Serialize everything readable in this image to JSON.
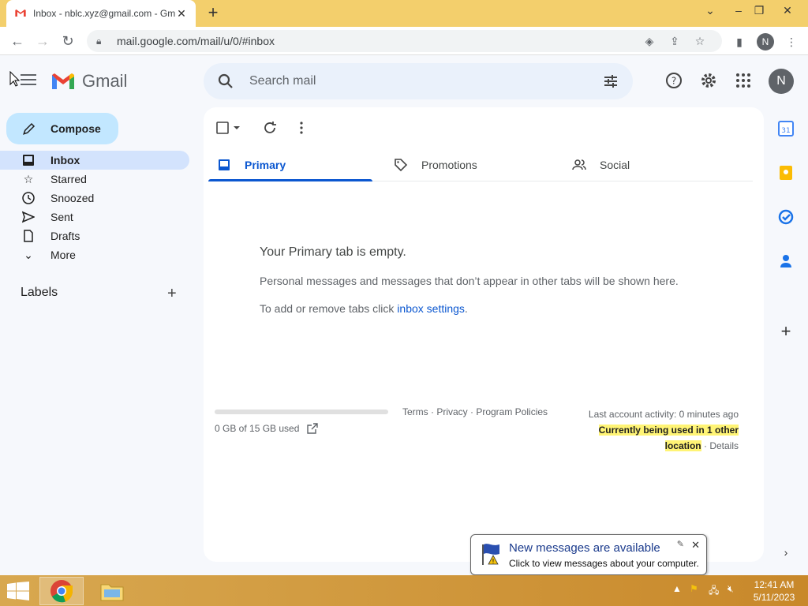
{
  "browser": {
    "tab_title": "Inbox - nblc.xyz@gmail.com - Gmail",
    "url": "mail.google.com/mail/u/0/#inbox",
    "profile_initial": "N"
  },
  "gmail": {
    "logo_text": "Gmail",
    "search_placeholder": "Search mail",
    "avatar_initial": "N",
    "compose_label": "Compose",
    "nav": [
      {
        "label": "Inbox"
      },
      {
        "label": "Starred"
      },
      {
        "label": "Snoozed"
      },
      {
        "label": "Sent"
      },
      {
        "label": "Drafts"
      },
      {
        "label": "More"
      }
    ],
    "labels_heading": "Labels",
    "tabs": [
      {
        "label": "Primary"
      },
      {
        "label": "Promotions"
      },
      {
        "label": "Social"
      }
    ],
    "empty": {
      "title": "Your Primary tab is empty.",
      "description": "Personal messages and messages that don’t appear in other tabs will be shown here.",
      "add_prefix": "To add or remove tabs click ",
      "add_link": "inbox settings",
      "add_suffix": "."
    },
    "storage": {
      "used_text": "0 GB of 15 GB used",
      "fraction_used": 0.0
    },
    "footer_links": "Terms · Privacy · Program Policies",
    "activity": {
      "last": "Last account activity: 0 minutes ago",
      "highlight": "Currently being used in 1 other location",
      "details": "Details",
      "separator": " · "
    }
  },
  "notification": {
    "title": "New messages are available",
    "text": "Click to view messages about your computer."
  },
  "taskbar": {
    "time": "12:41 AM",
    "date": "5/11/2023"
  },
  "colors": {
    "accent": "#0b57d0",
    "compose_bg": "#c2e7ff",
    "active_nav": "#d3e3fd",
    "tabstrip": "#f3cf6c"
  }
}
